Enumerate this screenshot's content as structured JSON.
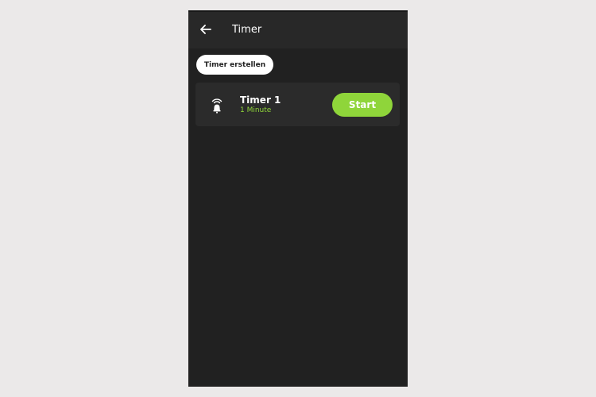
{
  "header": {
    "title": "Timer",
    "back_icon": "arrow-left-icon"
  },
  "actions": {
    "create_timer_label": "Timer erstellen"
  },
  "timers": [
    {
      "name": "Timer 1",
      "duration": "1 Minute",
      "icon": "bell-icon",
      "start_label": "Start"
    }
  ],
  "colors": {
    "accent": "#8fd53a",
    "background": "#212121",
    "card": "#2b2b2b",
    "topbar": "#282828"
  }
}
